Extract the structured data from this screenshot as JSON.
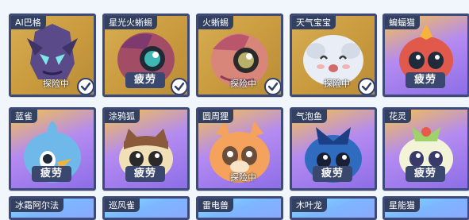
{
  "status_labels": {
    "fatigue": "疲劳",
    "exploring": "探险中"
  },
  "cards": [
    {
      "name": "AI巴格",
      "status": "探险中",
      "checked": true
    },
    {
      "name": "星光火蜥蜴",
      "status": "疲劳",
      "checked": true
    },
    {
      "name": "火蜥蜴",
      "status": "探险中",
      "checked": true
    },
    {
      "name": "天气宝宝",
      "status": "探险中",
      "checked": true
    },
    {
      "name": "蝙蝠猫",
      "status": "疲劳",
      "checked": false
    },
    {
      "name": "蓝雀",
      "status": "疲劳",
      "checked": false
    },
    {
      "name": "涂鸦狐",
      "status": "疲劳",
      "checked": false
    },
    {
      "name": "圆周狸",
      "status": "探险中",
      "checked": false
    },
    {
      "name": "气泡鱼",
      "status": "疲劳",
      "checked": false
    },
    {
      "name": "花灵",
      "status": "疲劳",
      "checked": false
    },
    {
      "name": "冰霜阿尔法"
    },
    {
      "name": "巡风雀"
    },
    {
      "name": "雷电兽"
    },
    {
      "name": "木叶龙"
    },
    {
      "name": "星能猫"
    }
  ],
  "colors": {
    "navy": "#33405f",
    "gold": "#c99a3e",
    "purple": "#9c7df0",
    "check": "#2f3f66"
  }
}
